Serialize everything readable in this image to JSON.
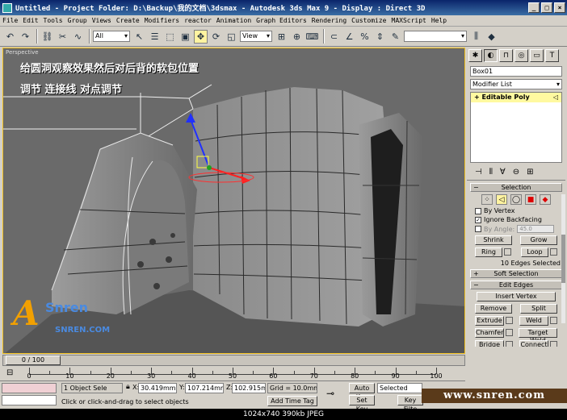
{
  "window": {
    "title": "Untitled   - Project Folder: D:\\Backup\\我的文档\\3dsmax   - Autodesk 3ds Max 9   - Display : Direct 3D"
  },
  "menu": [
    "File",
    "Edit",
    "Tools",
    "Group",
    "Views",
    "Create",
    "Modifiers",
    "reactor",
    "Animation",
    "Graph Editors",
    "Rendering",
    "Customize",
    "MAXScript",
    "Help"
  ],
  "toolbar": {
    "selection_filter": "All",
    "reference_coord": "View"
  },
  "viewport": {
    "label": "Perspective",
    "caption_line1": "给圆洞观察效果然后对后背的软包位置",
    "caption_line2": "调节  连接线  对点调节",
    "logo_text": "Snren",
    "logo_sub": "SNREN.COM"
  },
  "command_panel": {
    "object_name": "Box01",
    "modifier_list": "Modifier List",
    "stack_item": "Editable Poly",
    "selection": {
      "title": "Selection",
      "by_vertex": "By Vertex",
      "ignore_backfacing": "Ignore Backfacing",
      "by_angle": "By Angle:",
      "angle_value": "45.0",
      "shrink": "Shrink",
      "grow": "Grow",
      "ring": "Ring",
      "loop": "Loop",
      "count": "10 Edges Selected"
    },
    "soft_selection": "Soft Selection",
    "edit_edges": {
      "title": "Edit Edges",
      "insert_vertex": "Insert Vertex",
      "remove": "Remove",
      "split": "Split",
      "extrude": "Extrude",
      "weld": "Weld",
      "chamfer": "Chamfer",
      "target_weld": "Target Weld",
      "bridge": "Bridge",
      "connect": "Connect"
    }
  },
  "timeline": {
    "frame": "0 / 100",
    "ticks": [
      "0",
      "10",
      "20",
      "30",
      "40",
      "50",
      "60",
      "70",
      "80",
      "90",
      "100"
    ]
  },
  "status": {
    "selected": "1 Object Sele",
    "prompt": "Click or click-and-drag to select objects",
    "x_label": "X:",
    "x_value": "30.419mm",
    "y_label": "Y:",
    "y_value": "107.214mm",
    "z_label": "Z:",
    "z_value": "102.915mm",
    "grid": "Grid = 10.0mm",
    "add_time_tag": "Add Time Tag",
    "auto_key": "Auto Key",
    "set_key": "Set Key",
    "key_mode": "Selected",
    "key_filters": "Key Filte"
  },
  "watermark": "www.snren.com",
  "image_info": "1024x740  390kb  JPEG"
}
